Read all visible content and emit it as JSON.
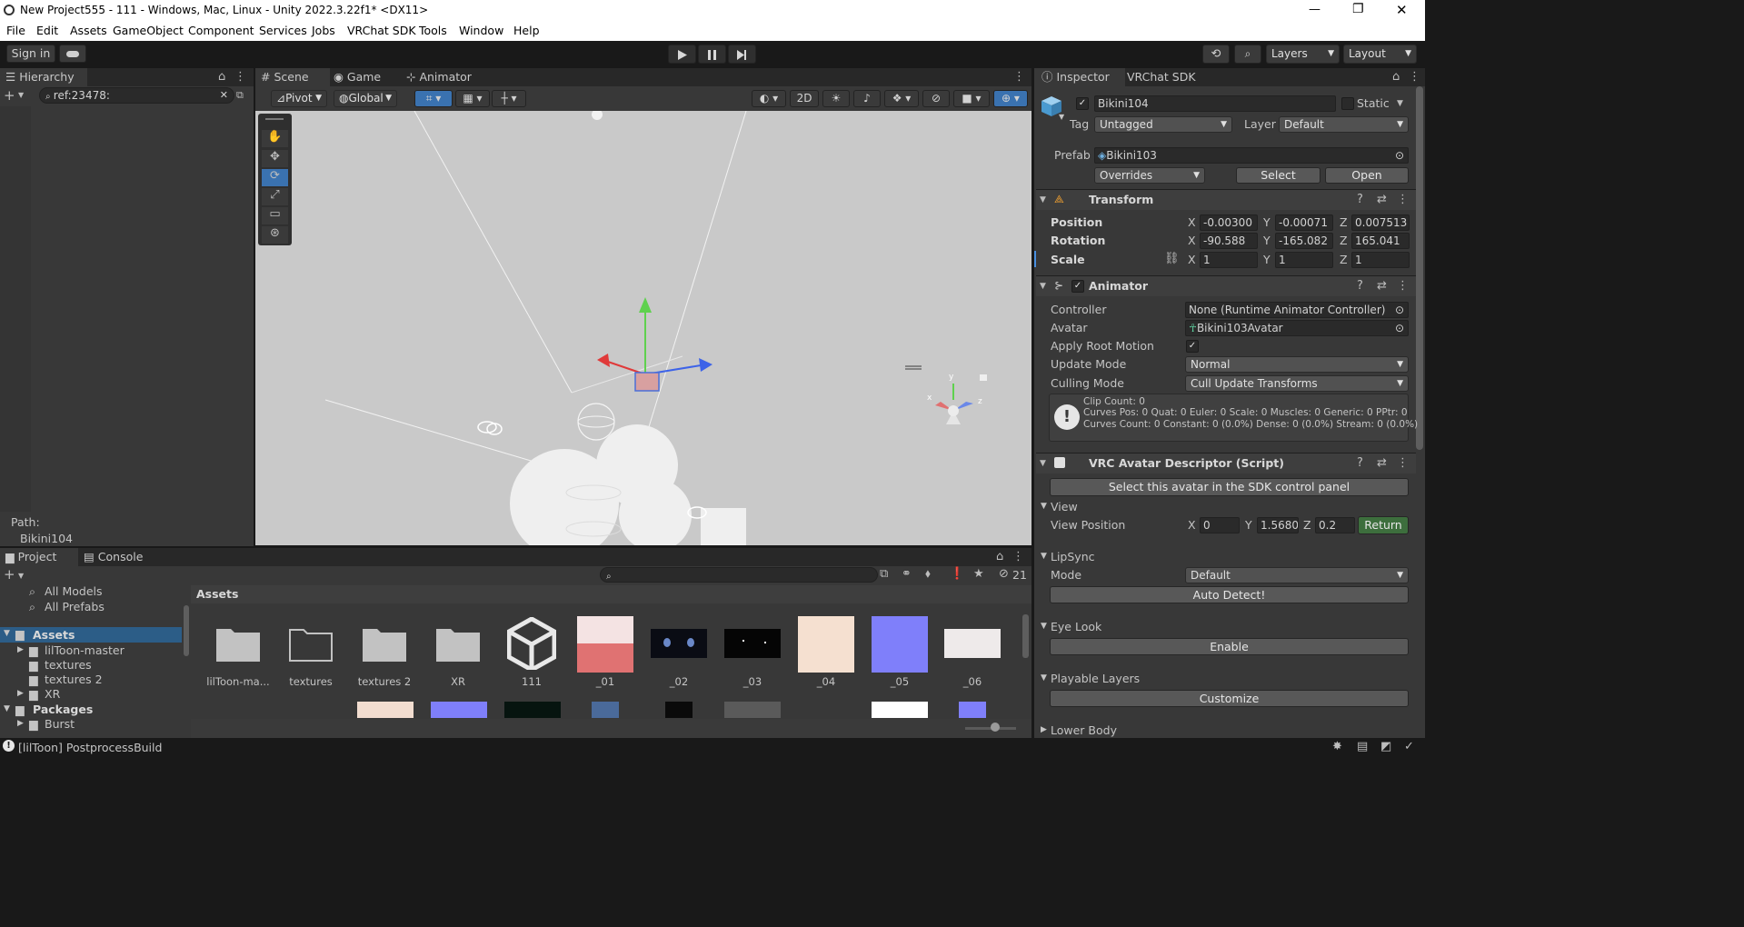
{
  "window": {
    "title": "New Project555 - 111 - Windows, Mac, Linux - Unity 2022.3.22f1* <DX11>",
    "controls": {
      "minimize": "—",
      "restore": "❐",
      "close": "✕"
    }
  },
  "menu": [
    "File",
    "Edit",
    "Assets",
    "GameObject",
    "Component",
    "Services",
    "Jobs",
    "VRChat SDK",
    "Tools",
    "Window",
    "Help"
  ],
  "toolbar": {
    "sign_in": "Sign in",
    "layers": "Layers",
    "layout": "Layout"
  },
  "hierarchy": {
    "tab": "Hierarchy",
    "search_value": "ref:23478:",
    "path_label": "Path:",
    "path_value": "Bikini104"
  },
  "scene_tabs": [
    "Scene",
    "Game",
    "Animator"
  ],
  "scene_toolbar": {
    "pivot": "Pivot",
    "global": "Global",
    "mode_2d": "2D"
  },
  "inspector": {
    "tabs": [
      "Inspector",
      "VRChat SDK"
    ],
    "object_name": "Bikini104",
    "static_label": "Static",
    "tag_label": "Tag",
    "tag_value": "Untagged",
    "layer_label": "Layer",
    "layer_value": "Default",
    "prefab_label": "Prefab",
    "prefab_value": "Bikini103",
    "overrides": "Overrides",
    "select": "Select",
    "open": "Open",
    "transform": {
      "title": "Transform",
      "position_label": "Position",
      "rotation_label": "Rotation",
      "scale_label": "Scale",
      "position": {
        "x": "-0.00300",
        "y": "-0.00071",
        "z": "0.007513"
      },
      "rotation": {
        "x": "-90.588",
        "y": "-165.082",
        "z": "165.041"
      },
      "scale": {
        "x": "1",
        "y": "1",
        "z": "1"
      }
    },
    "animator": {
      "title": "Animator",
      "controller_label": "Controller",
      "controller_value": "None (Runtime Animator Controller)",
      "avatar_label": "Avatar",
      "avatar_value": "Bikini103Avatar",
      "apply_root_motion_label": "Apply Root Motion",
      "update_mode_label": "Update Mode",
      "update_mode_value": "Normal",
      "culling_mode_label": "Culling Mode",
      "culling_mode_value": "Cull Update Transforms",
      "info_line1": "Clip Count: 0",
      "info_line2": "Curves Pos: 0 Quat: 0 Euler: 0 Scale: 0 Muscles: 0 Generic: 0 PPtr: 0",
      "info_line3": "Curves Count: 0 Constant: 0 (0.0%) Dense: 0 (0.0%) Stream: 0 (0.0%)"
    },
    "vrc": {
      "title": "VRC Avatar Descriptor (Script)",
      "select_avatar": "Select this avatar in the SDK control panel",
      "view_section": "View",
      "view_position_label": "View Position",
      "view_position": {
        "x": "0",
        "y": "1.5680",
        "z": "0.2"
      },
      "return": "Return",
      "lipsync_section": "LipSync",
      "mode_label": "Mode",
      "mode_value": "Default",
      "auto_detect": "Auto Detect!",
      "eye_look_section": "Eye Look",
      "enable": "Enable",
      "playable_layers_section": "Playable Layers",
      "customize": "Customize",
      "lower_body_section": "Lower Body"
    }
  },
  "project": {
    "tabs": [
      "Project",
      "Console"
    ],
    "hidden_count": "21",
    "tree": {
      "all_models": "All Models",
      "all_prefabs": "All Prefabs",
      "assets": "Assets",
      "liltoon": "lilToon-master",
      "textures": "textures",
      "textures2": "textures 2",
      "xr": "XR",
      "packages": "Packages",
      "burst": "Burst"
    },
    "breadcrumb": "Assets",
    "items": [
      "lilToon-ma...",
      "textures",
      "textures 2",
      "XR",
      "111",
      "_01",
      "_02",
      "_03",
      "_04",
      "_05",
      "_06"
    ]
  },
  "status": {
    "message": "[lilToon] PostprocessBuild"
  },
  "colors": {
    "accent_blue": "#3a72b0",
    "return_green": "#3d6e3d"
  }
}
